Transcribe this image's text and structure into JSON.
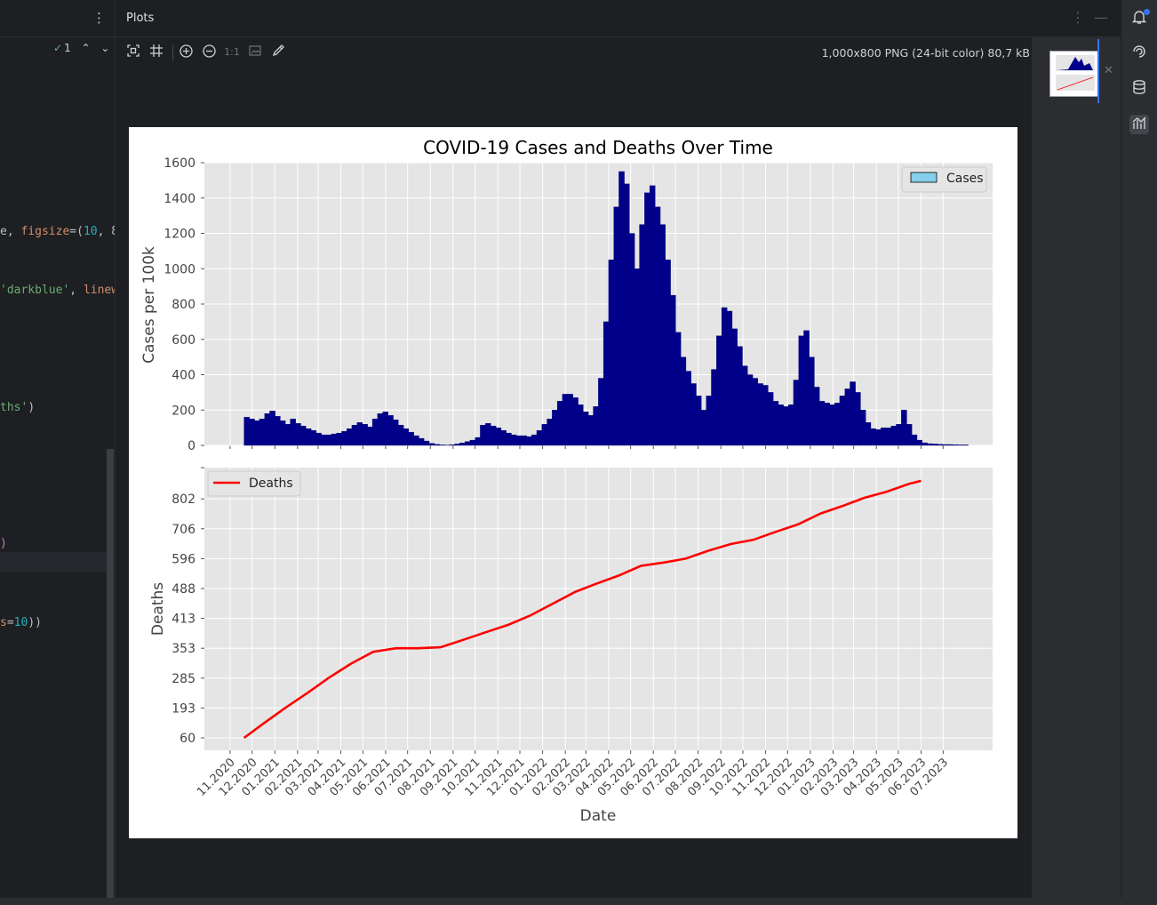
{
  "editor": {
    "inspection_count": "1",
    "lines": [
      {
        "y": 265,
        "segments": [
          [
            "e, ",
            "tok-id"
          ],
          [
            "figsize",
            "tok-par"
          ],
          [
            "=(",
            "tok-id"
          ],
          [
            "10",
            "tok-num"
          ],
          [
            ", 8",
            "tok-id"
          ]
        ]
      },
      {
        "y": 331,
        "segments": [
          [
            "'darkblue'",
            "tok-str"
          ],
          [
            ", ",
            "tok-id"
          ],
          [
            "linew",
            "tok-par"
          ]
        ]
      },
      {
        "y": 463,
        "segments": [
          [
            "ths'",
            "tok-str"
          ],
          [
            ")",
            "tok-id"
          ]
        ]
      },
      {
        "y": 616,
        "segments": [
          [
            ")",
            "tok-kw"
          ]
        ]
      },
      {
        "y": 705,
        "segments": [
          [
            "s",
            "tok-par"
          ],
          [
            "=",
            "tok-id"
          ],
          [
            "10",
            "tok-num"
          ],
          [
            "))",
            "tok-id"
          ]
        ]
      }
    ]
  },
  "plots_panel": {
    "title": "Plots",
    "image_info": "1,000x800 PNG (24-bit color) 80,7 kB",
    "toolbar": {
      "fit_icon": "fit-to-window-icon",
      "actual_size_label": "1:1"
    }
  },
  "colors": {
    "cases_fill": "#00008b",
    "cases_legend": "#87ceeb",
    "deaths_line": "#ff0000",
    "axes_bg": "#e5e5e5",
    "grid": "#ffffff"
  },
  "chart_data": [
    {
      "type": "bar",
      "title": "COVID-19 Cases and Deaths Over Time",
      "ylabel": "Cases per 100k",
      "legend": {
        "entries": [
          "Cases"
        ],
        "placement": "top-right"
      },
      "ylim": [
        0,
        1600
      ],
      "yticks": [
        0,
        200,
        400,
        600,
        800,
        1000,
        1200,
        1400,
        1600
      ],
      "grid": true,
      "x_start": "2020-11-20",
      "x_step_days": 7,
      "values": [
        160,
        150,
        140,
        150,
        180,
        195,
        165,
        140,
        120,
        150,
        125,
        110,
        95,
        85,
        70,
        60,
        60,
        65,
        70,
        80,
        95,
        115,
        130,
        120,
        105,
        150,
        180,
        190,
        170,
        145,
        115,
        95,
        75,
        55,
        40,
        25,
        12,
        6,
        3,
        2,
        4,
        8,
        14,
        22,
        30,
        45,
        115,
        125,
        110,
        100,
        85,
        70,
        60,
        55,
        55,
        50,
        60,
        85,
        120,
        150,
        200,
        250,
        290,
        290,
        270,
        230,
        190,
        170,
        220,
        380,
        700,
        1050,
        1350,
        1550,
        1480,
        1200,
        1000,
        1250,
        1430,
        1470,
        1350,
        1250,
        1050,
        850,
        640,
        500,
        420,
        350,
        280,
        200,
        280,
        430,
        620,
        780,
        760,
        660,
        560,
        450,
        400,
        380,
        350,
        340,
        300,
        250,
        230,
        220,
        230,
        370,
        620,
        650,
        500,
        330,
        250,
        240,
        230,
        240,
        280,
        320,
        360,
        300,
        200,
        130,
        95,
        90,
        100,
        100,
        110,
        120,
        200,
        120,
        60,
        30,
        15,
        10,
        8,
        6,
        5,
        5,
        4,
        3,
        3
      ]
    },
    {
      "type": "line",
      "ylabel": "Deaths",
      "xlabel": "Date",
      "legend": {
        "entries": [
          "Deaths"
        ],
        "placement": "top-left"
      },
      "yticks": [
        60,
        193,
        285,
        353,
        413,
        488,
        596,
        706,
        802
      ],
      "ytick_labels": [
        "60",
        "193",
        "285",
        "353",
        "413",
        "488",
        "596",
        "706",
        "802"
      ],
      "grid": true,
      "x_start": "2020-11-20",
      "x_end": "2023-06-01",
      "xtick_labels": [
        "11.2020",
        "12.2020",
        "01.2021",
        "02.2021",
        "03.2021",
        "04.2021",
        "05.2021",
        "06.2021",
        "07.2021",
        "08.2021",
        "09.2021",
        "10.2021",
        "11.2021",
        "12.2021",
        "01.2022",
        "02.2022",
        "03.2022",
        "04.2022",
        "05.2022",
        "06.2022",
        "07.2022",
        "08.2022",
        "09.2022",
        "10.2022",
        "11.2022",
        "12.2022",
        "01.2023",
        "02.2023",
        "03.2023",
        "04.2023",
        "05.2023",
        "06.2023",
        "07.2023"
      ],
      "series": [
        {
          "name": "Deaths",
          "points": [
            [
              "2020-11-20",
              60
            ],
            [
              "2020-12-15",
              120
            ],
            [
              "2021-01-15",
              193
            ],
            [
              "2021-02-15",
              240
            ],
            [
              "2021-03-15",
              285
            ],
            [
              "2021-04-15",
              318
            ],
            [
              "2021-05-15",
              345
            ],
            [
              "2021-06-15",
              353
            ],
            [
              "2021-07-15",
              353
            ],
            [
              "2021-08-15",
              355
            ],
            [
              "2021-09-15",
              370
            ],
            [
              "2021-10-15",
              385
            ],
            [
              "2021-11-15",
              400
            ],
            [
              "2021-12-15",
              420
            ],
            [
              "2022-01-15",
              450
            ],
            [
              "2022-02-15",
              480
            ],
            [
              "2022-03-15",
              505
            ],
            [
              "2022-04-15",
              535
            ],
            [
              "2022-05-15",
              570
            ],
            [
              "2022-06-15",
              582
            ],
            [
              "2022-07-15",
              596
            ],
            [
              "2022-08-15",
              625
            ],
            [
              "2022-09-15",
              650
            ],
            [
              "2022-10-15",
              665
            ],
            [
              "2022-11-15",
              695
            ],
            [
              "2022-12-15",
              720
            ],
            [
              "2023-01-15",
              755
            ],
            [
              "2023-02-15",
              780
            ],
            [
              "2023-03-15",
              805
            ],
            [
              "2023-04-15",
              825
            ],
            [
              "2023-05-15",
              850
            ],
            [
              "2023-06-01",
              860
            ]
          ]
        }
      ]
    }
  ]
}
